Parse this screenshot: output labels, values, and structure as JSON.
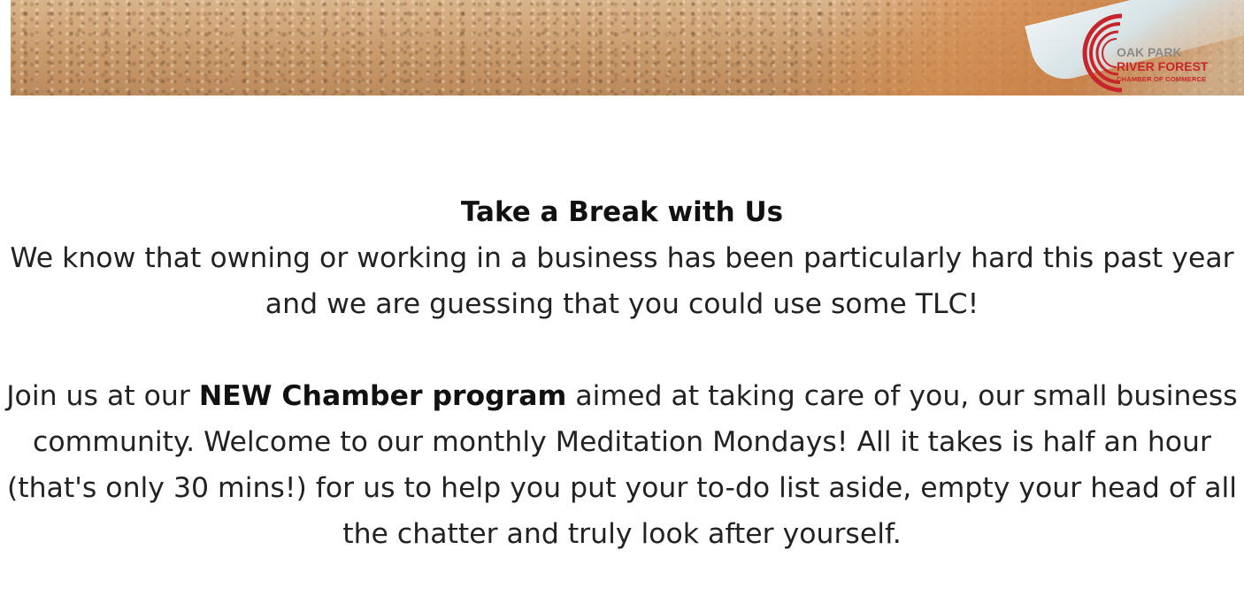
{
  "banner": {
    "image_description": "sandy beach with footprints and ocean wave foam"
  },
  "logo": {
    "line1": "OAK PARK",
    "line2": "RIVER FOREST",
    "line3": "CHAMBER OF COMMERCE",
    "colors": {
      "red": "#c8242b",
      "gray": "#8a8a8a"
    }
  },
  "content": {
    "headline": "Take a Break with Us",
    "paragraph1": "We know that owning or working in a business has been particularly hard this past year and we are guessing that you could use some TLC!",
    "paragraph2": {
      "before": "Join us at our ",
      "strong": "NEW Chamber program",
      "after": " aimed at taking care of you, our small business community. Welcome to our monthly Meditation Mondays! All it takes is half an hour (that's only 30 mins!) for us to help you put your to-do list aside, empty your head of all the chatter and truly look after yourself."
    }
  }
}
